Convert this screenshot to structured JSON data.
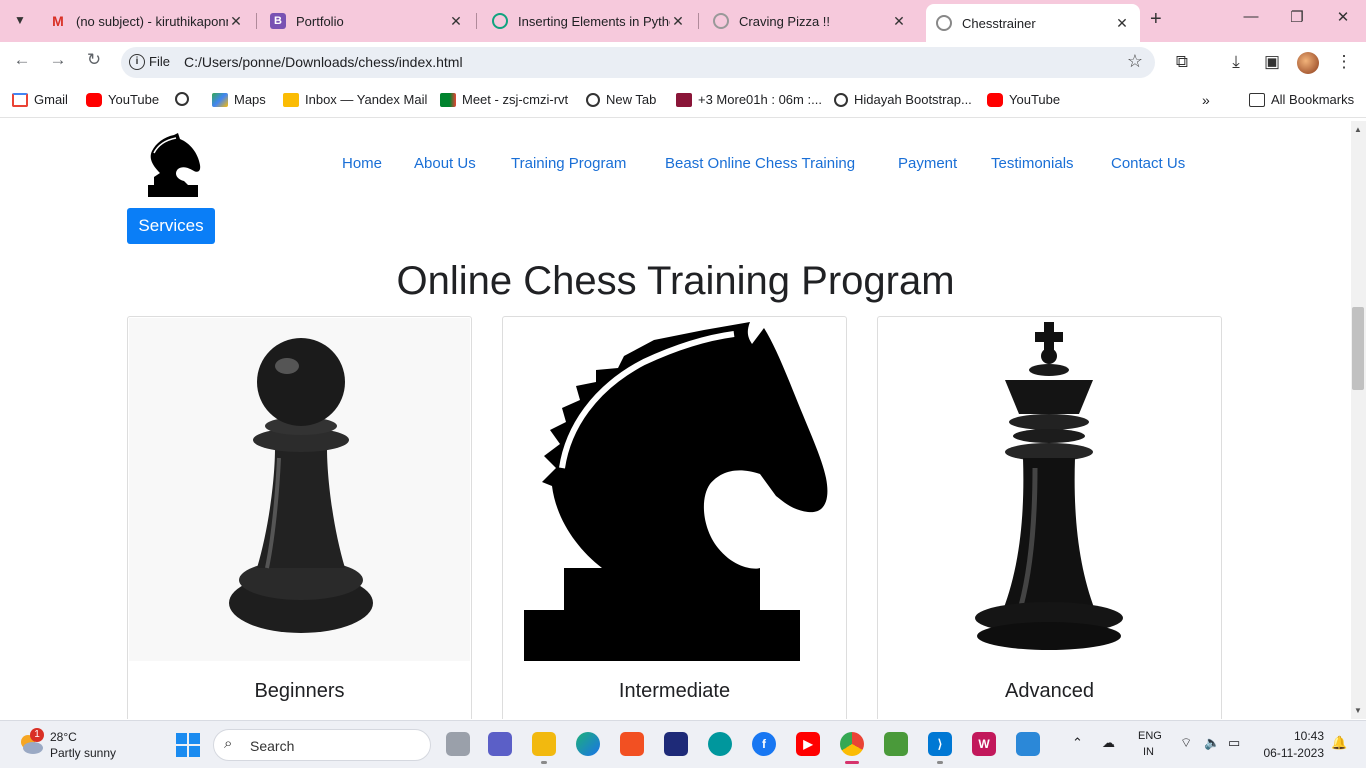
{
  "browser": {
    "tabs": [
      {
        "title": "(no subject) - kiruthikaponn",
        "favicon": "gmail-icon",
        "color": "#d93025"
      },
      {
        "title": "Portfolio",
        "favicon": "bootstrap-icon",
        "color": "#7952b3"
      },
      {
        "title": "Inserting Elements in Pytho",
        "favicon": "chatgpt-icon",
        "color": "#10a37f"
      },
      {
        "title": "Craving Pizza !!",
        "favicon": "globe-icon",
        "color": "#888888"
      },
      {
        "title": "Chesstrainer",
        "favicon": "globe-icon",
        "color": "#888888"
      }
    ],
    "active_tab": 4,
    "omnibox": {
      "scheme_label": "File",
      "url": "C:/Users/ponne/Downloads/chess/index.html"
    },
    "bookmarks": [
      {
        "label": "Gmail",
        "icon": "gmail-icon",
        "color": "#ea4335"
      },
      {
        "label": "YouTube",
        "icon": "youtube-icon",
        "color": "#ff0000"
      },
      {
        "label": "",
        "icon": "globe-icon",
        "color": "#333333"
      },
      {
        "label": "Maps",
        "icon": "maps-icon",
        "color": "#34a853"
      },
      {
        "label": "Inbox — Yandex Mail",
        "icon": "mail-icon",
        "color": "#fbbc04"
      },
      {
        "label": "Meet - zsj-cmzi-rvt",
        "icon": "meet-icon",
        "color": "#00832d"
      },
      {
        "label": "New Tab",
        "icon": "globe-icon",
        "color": "#333333"
      },
      {
        "label": "+3 More01h : 06m :...",
        "icon": "m-icon",
        "color": "#8a1538"
      },
      {
        "label": "Hidayah Bootstrap...",
        "icon": "globe-icon",
        "color": "#333333"
      },
      {
        "label": "YouTube",
        "icon": "youtube-icon",
        "color": "#ff0000"
      }
    ],
    "all_bookmarks": "All Bookmarks"
  },
  "page": {
    "nav": [
      "Home",
      "About Us",
      "Training Program",
      "Beast Online Chess Training",
      "Payment",
      "Testimonials",
      "Contact Us"
    ],
    "services_button": "Services",
    "heading": "Online Chess Training Program",
    "cards": [
      {
        "title": "Beginners",
        "image": "pawn-icon"
      },
      {
        "title": "Intermediate",
        "image": "knight-icon"
      },
      {
        "title": "Advanced",
        "image": "king-icon"
      }
    ],
    "accent_color": "#0a7ef7",
    "link_color": "#1a6fd6"
  },
  "taskbar": {
    "weather": {
      "badge": "1",
      "temp": "28°C",
      "desc": "Partly sunny"
    },
    "search_label": "Search",
    "language": {
      "line1": "ENG",
      "line2": "IN"
    },
    "clock": {
      "time": "10:43",
      "date": "06-11-2023"
    }
  }
}
